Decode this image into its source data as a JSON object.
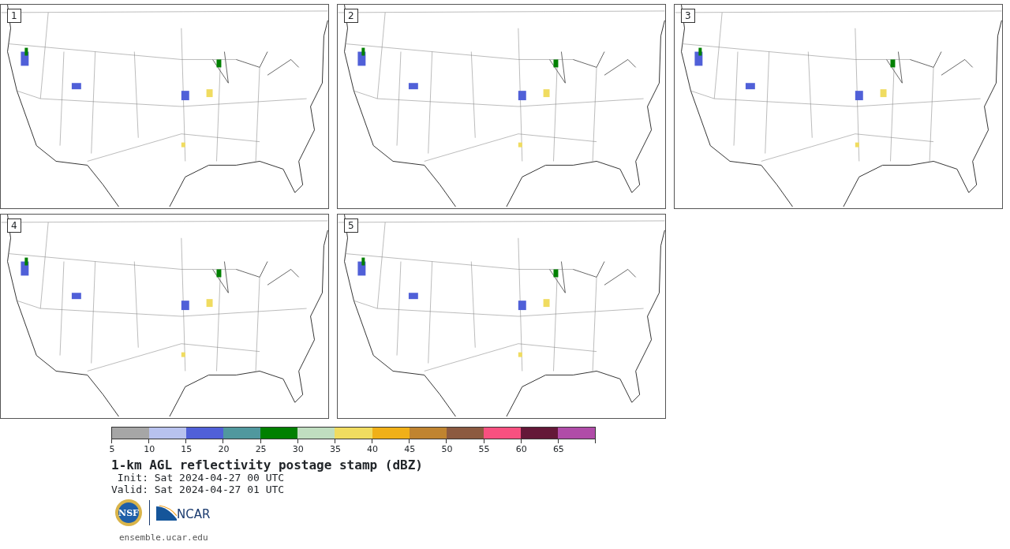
{
  "panels": [
    {
      "number": "1"
    },
    {
      "number": "2"
    },
    {
      "number": "3"
    },
    {
      "number": "4"
    },
    {
      "number": "5"
    }
  ],
  "colorbar": {
    "segments": [
      {
        "color": "#a6a6a6"
      },
      {
        "color": "#b8c2ee"
      },
      {
        "color": "#5060d8"
      },
      {
        "color": "#50989e"
      },
      {
        "color": "#008000"
      },
      {
        "color": "#c0dec0"
      },
      {
        "color": "#f0dc60"
      },
      {
        "color": "#f0b018"
      },
      {
        "color": "#c08430"
      },
      {
        "color": "#8c5a40"
      },
      {
        "color": "#f85080"
      },
      {
        "color": "#641838"
      },
      {
        "color": "#b04ca8"
      }
    ],
    "tick_labels": [
      "5",
      "10",
      "15",
      "20",
      "25",
      "30",
      "35",
      "40",
      "45",
      "50",
      "55",
      "60",
      "65"
    ]
  },
  "title": "1-km AGL reflectivity postage stamp (dBZ)",
  "init": " Init: Sat 2024-04-27 00 UTC",
  "valid": "Valid: Sat 2024-04-27 01 UTC",
  "logos": {
    "nsf": "NSF",
    "ncar": "NCAR"
  },
  "footer_link": "ensemble.ucar.edu"
}
